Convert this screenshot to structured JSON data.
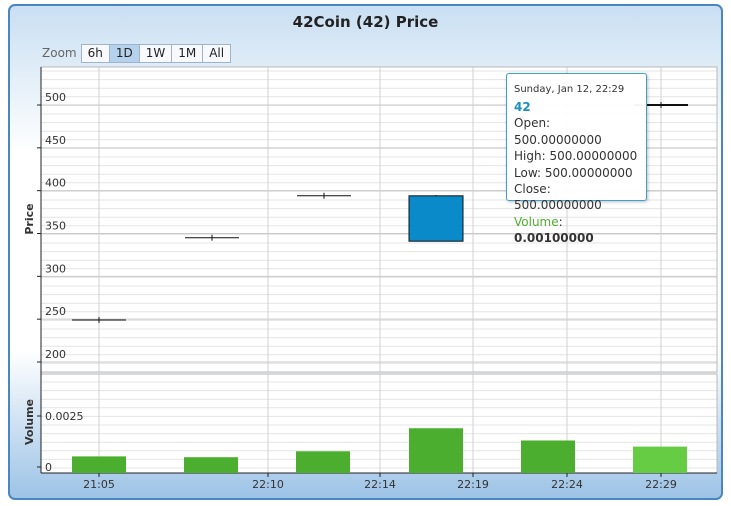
{
  "title": "42Coin (42) Price",
  "zoom": {
    "label": "Zoom",
    "buttons": [
      "6h",
      "1D",
      "1W",
      "1M",
      "All"
    ],
    "selected": "1D"
  },
  "colors": {
    "frame": "#4a86c0",
    "candle_up": "#0b8ac9",
    "volume": "#4cae2e",
    "volume_highlight": "#66cc44",
    "tooltip_border": "#3f9fcf",
    "series_label": "#1a8fc0"
  },
  "chart_data": [
    {
      "type": "candlestick",
      "ylabel": "Price",
      "ylim": [
        200,
        500
      ],
      "yticks": [
        200,
        250,
        300,
        350,
        400,
        450,
        500
      ],
      "grid": true,
      "x_tick_labels": [
        "21:05",
        "22:10",
        "22:14",
        "22:19",
        "22:24",
        "22:29"
      ],
      "candles": [
        {
          "open": 249,
          "high": 249,
          "low": 249,
          "close": 249
        },
        {
          "open": 345,
          "high": 345,
          "low": 345,
          "close": 345
        },
        {
          "open": 394,
          "high": 394,
          "low": 394,
          "close": 394
        },
        {
          "open": 341,
          "high": 395,
          "low": 341,
          "close": 394
        },
        {
          "open": 500,
          "high": 500,
          "low": 500,
          "close": 500
        }
      ]
    },
    {
      "type": "bar",
      "ylabel": "Volume",
      "ylim": [
        0,
        0.0045
      ],
      "yticks": [
        "0",
        "0.0025"
      ],
      "values": [
        0.00052,
        0.00048,
        0.00077,
        0.0019,
        0.0013,
        0.001
      ]
    }
  ],
  "tooltip": {
    "date": "Sunday, Jan 12, 22:29",
    "series": "42",
    "open": "Open: 500.00000000",
    "high": "High: 500.00000000",
    "low": "Low: 500.00000000",
    "close": "Close: 500.00000000",
    "volume_label": "Volume",
    "volume_value": "0.00100000"
  }
}
